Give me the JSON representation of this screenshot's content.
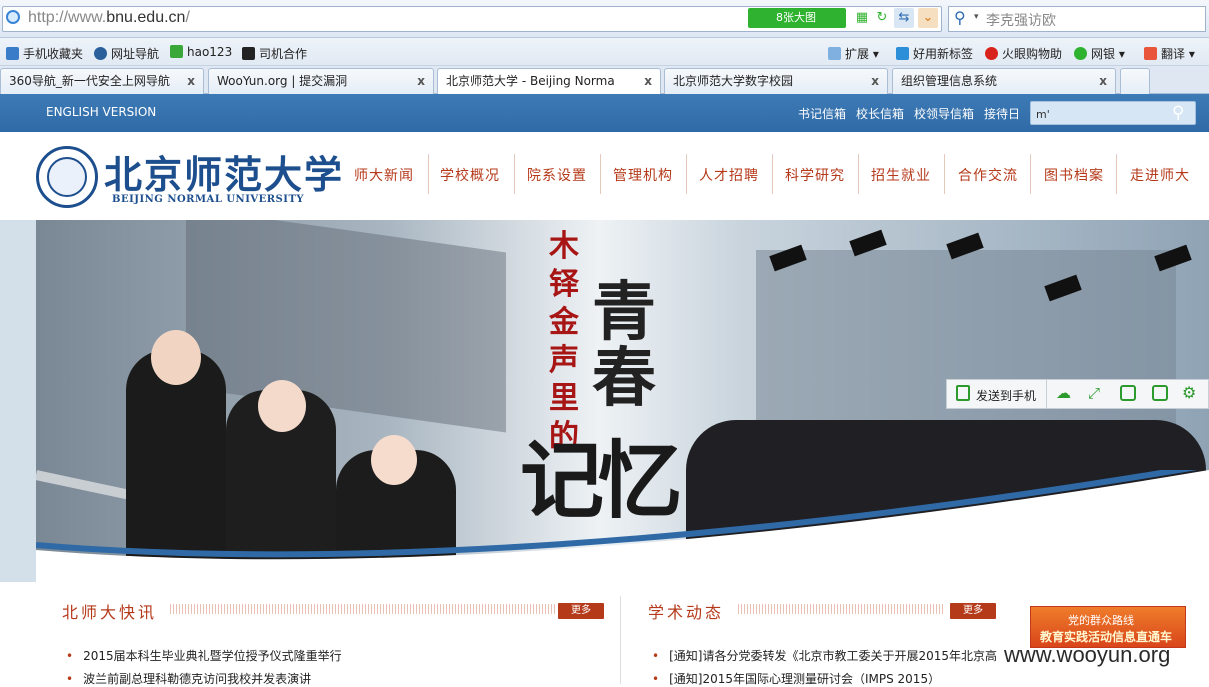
{
  "browser": {
    "url_prefix": "http://www.",
    "url_domain": "bnu.edu.cn",
    "url_suffix": "/",
    "big_image_button": "8张大图",
    "search_placeholder": "李克强访欧"
  },
  "bookmarks": [
    {
      "label": "手机收藏夹",
      "icon": "phone-icon"
    },
    {
      "label": "网址导航",
      "icon": "compass-icon"
    },
    {
      "label": "hao123",
      "icon": "hao123-icon"
    },
    {
      "label": "司机合作",
      "icon": "car-icon"
    }
  ],
  "bookmarks_right": [
    {
      "label": "扩展",
      "icon": "extensions-icon"
    },
    {
      "label": "好用新标签",
      "icon": "grid-icon"
    },
    {
      "label": "火眼购物助",
      "icon": "eye-icon"
    },
    {
      "label": "网银",
      "icon": "bank-icon"
    },
    {
      "label": "翻译",
      "icon": "translate-icon"
    }
  ],
  "tabs": [
    {
      "label": "360导航_新一代安全上网导航",
      "close": "x"
    },
    {
      "label": "WooYun.org | 提交漏洞",
      "close": "x"
    },
    {
      "label": "北京师范大学 - Beijing Norma",
      "close": "x"
    },
    {
      "label": "北京师范大学数字校园",
      "close": "x"
    },
    {
      "label": "组织管理信息系统",
      "close": "x"
    }
  ],
  "site": {
    "english_version": "ENGLISH VERSION",
    "top_links": [
      "书记信箱",
      "校长信箱",
      "校领导信箱",
      "接待日"
    ],
    "search_value": "m'",
    "logo_cn": "北京师范大学",
    "logo_en": "BEIJING NORMAL UNIVERSITY",
    "nav": [
      "师大新闻",
      "学校概况",
      "院系设置",
      "管理机构",
      "人才招聘",
      "科学研究",
      "招生就业",
      "合作交流",
      "图书档案",
      "走进师大"
    ]
  },
  "banner": {
    "slogan_vertical": "木铎金声里的",
    "slogan_big": "青春",
    "slogan_bottom": "记忆"
  },
  "send_toolbar": {
    "label": "发送到手机",
    "icons": [
      "cloud-icon",
      "expand-icon",
      "save-icon",
      "share-icon",
      "settings-icon"
    ]
  },
  "sections": {
    "news": {
      "title": "北师大快讯",
      "more": "更多",
      "items": [
        "2015届本科生毕业典礼暨学位授予仪式隆重举行",
        "波兰前副总理科勒德克访问我校并发表演讲"
      ]
    },
    "academic": {
      "title": "学术动态",
      "more": "更多",
      "items": [
        "[通知]请各分党委转发《北京市教工委关于开展2015年北京高",
        "[通知]2015年国际心理测量研讨会（IMPS 2015）"
      ]
    },
    "promo": {
      "line1": "党的群众路线",
      "line2": "教育实践活动信息直通车"
    }
  },
  "watermark": "www.wooyun.org",
  "colors": {
    "site_bar": "#2f6aa6",
    "nav_text": "#b53a1a",
    "logo_blue": "#1d4f8e",
    "more_button": "#b53a1a"
  }
}
